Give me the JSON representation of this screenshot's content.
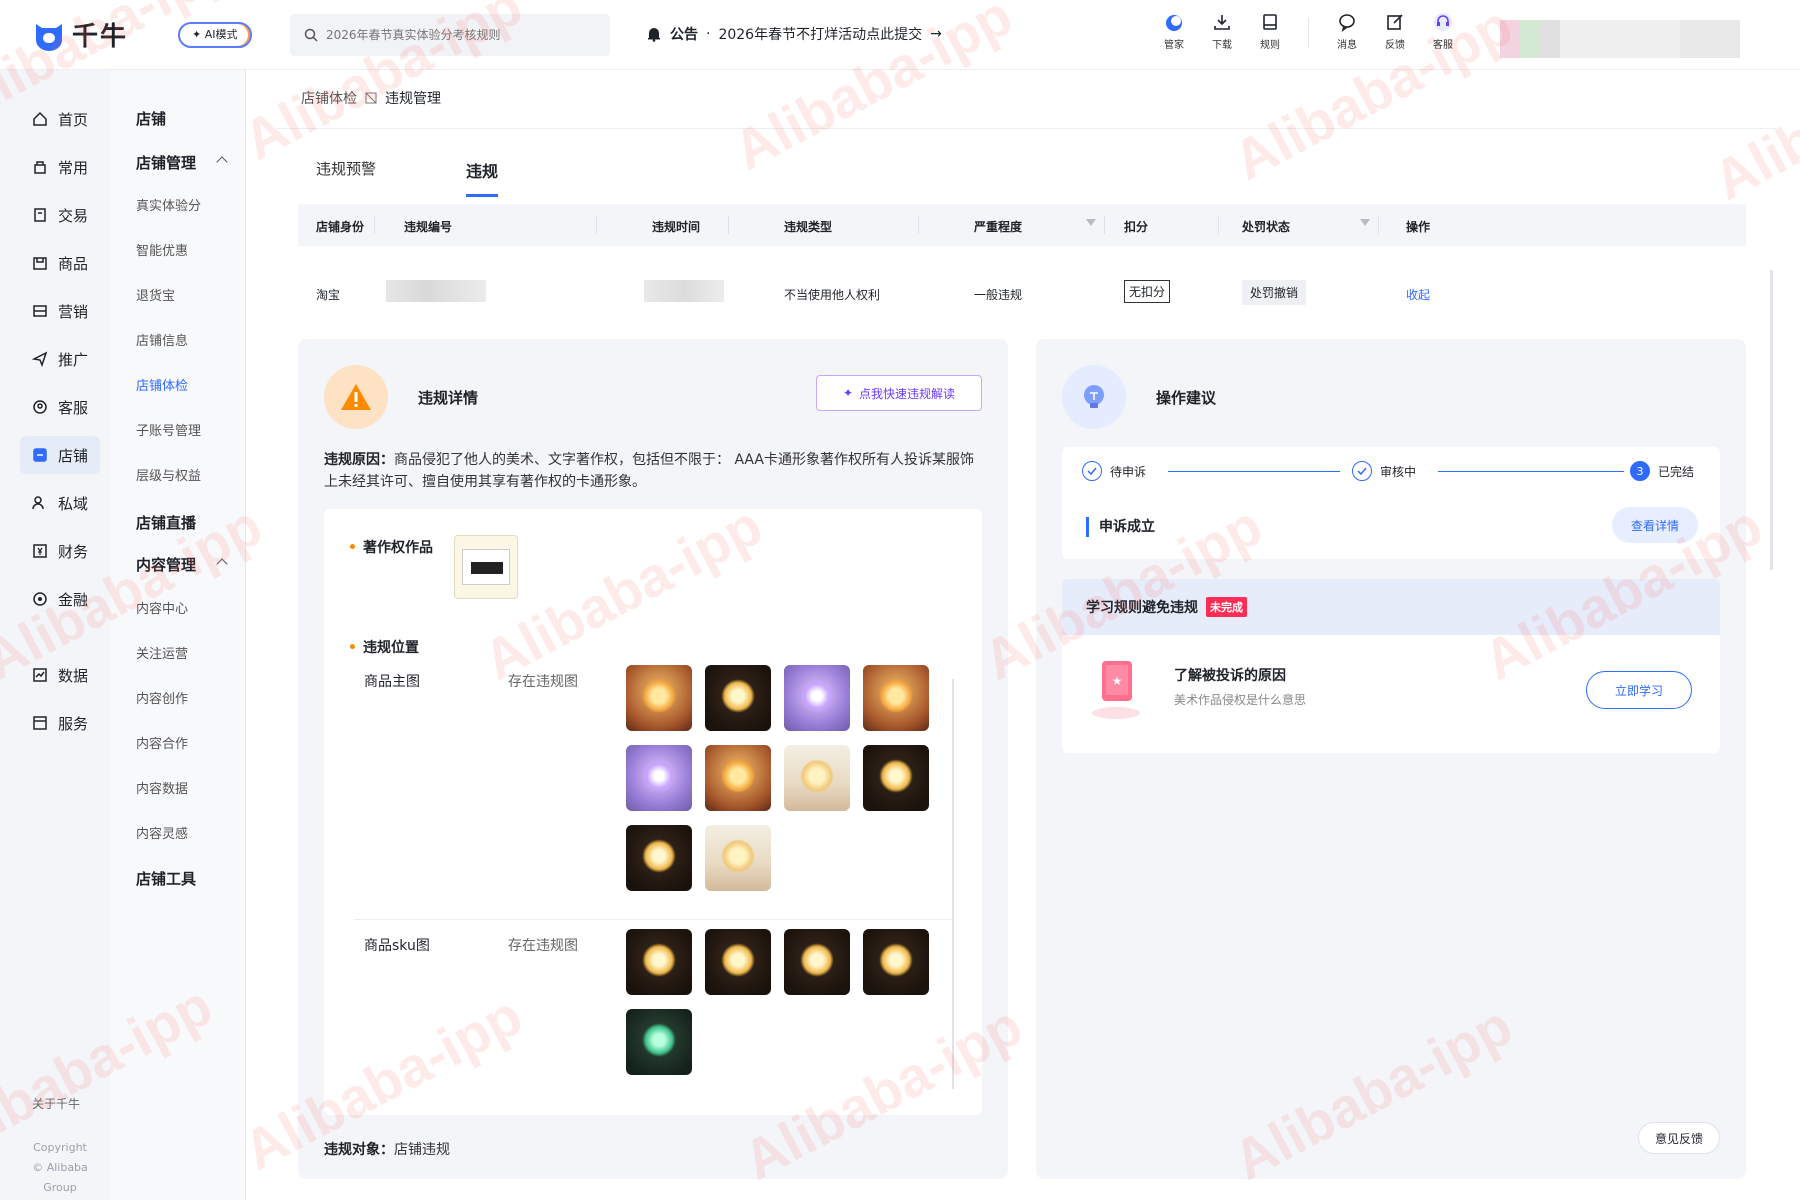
{
  "app": {
    "name": "千牛",
    "ai_mode": "AI模式"
  },
  "search": {
    "placeholder": "2026年春节真实体验分考核规则"
  },
  "notice": {
    "label": "公告",
    "sep": "·",
    "text": "2026年春节不打烊活动点此提交"
  },
  "top_icons": [
    {
      "label": "管家",
      "icon": "assistant-icon"
    },
    {
      "label": "下载",
      "icon": "download-icon"
    },
    {
      "label": "规则",
      "icon": "rule-book-icon"
    },
    {
      "label": "消息",
      "icon": "message-icon"
    },
    {
      "label": "反馈",
      "icon": "feedback-icon"
    },
    {
      "label": "客服",
      "icon": "headset-icon"
    }
  ],
  "nav_primary": [
    {
      "label": "首页",
      "icon": "home-icon"
    },
    {
      "label": "常用",
      "icon": "pin-icon"
    },
    {
      "label": "交易",
      "icon": "order-icon"
    },
    {
      "label": "商品",
      "icon": "goods-icon"
    },
    {
      "label": "营销",
      "icon": "marketing-icon"
    },
    {
      "label": "推广",
      "icon": "send-icon"
    },
    {
      "label": "客服",
      "icon": "service-icon"
    },
    {
      "label": "店铺",
      "icon": "shop-icon",
      "active": true
    },
    {
      "label": "私域",
      "icon": "users-icon"
    },
    {
      "label": "财务",
      "icon": "finance-icon"
    },
    {
      "label": "金融",
      "icon": "coin-icon"
    },
    {
      "label": "数据",
      "icon": "chart-icon"
    },
    {
      "label": "服务",
      "icon": "service-box-icon"
    }
  ],
  "nav_footer": {
    "about": "关于千牛",
    "copyright": "Copyright",
    "company": "© Alibaba Group"
  },
  "nav_secondary": {
    "shop": "店铺",
    "shop_manage": "店铺管理",
    "shop_manage_items": [
      "真实体验分",
      "智能优惠",
      "退货宝",
      "店铺信息",
      "店铺体检",
      "子账号管理",
      "层级与权益"
    ],
    "live": "店铺直播",
    "content_manage": "内容管理",
    "content_items": [
      "内容中心",
      "关注运营",
      "内容创作",
      "内容合作",
      "内容数据",
      "内容灵感"
    ],
    "tools": "店铺工具"
  },
  "breadcrumb": {
    "parent": "店铺体检",
    "current": "违规管理"
  },
  "tabs": [
    {
      "label": "违规预警"
    },
    {
      "label": "违规",
      "active": true
    }
  ],
  "table": {
    "headers": [
      "店铺身份",
      "违规编号",
      "违规时间",
      "违规类型",
      "严重程度",
      "扣分",
      "处罚状态",
      "操作"
    ],
    "row": {
      "identity": "淘宝",
      "type": "不当使用他人权利",
      "severity": "一般违规",
      "points": "无扣分",
      "status": "处罚撤销",
      "action": "收起"
    }
  },
  "detail": {
    "title": "违规详情",
    "ai_button": "点我快速违规解读",
    "reason_label": "违规原因：",
    "reason_text": "商品侵犯了他人的美术、文字著作权，包括但不限于： AAA卡通形象著作权所有人投诉某服饰上未经其许可、擅自使用其享有著作权的卡通形象。",
    "copyright_label": "著作权作品",
    "location_label": "违规位置",
    "main_image_label": "商品主图",
    "main_image_value": "存在违规图",
    "sku_image_label": "商品sku图",
    "sku_image_value": "存在违规图",
    "target_label": "违规对象：",
    "target_value": "店铺违规"
  },
  "advice": {
    "title": "操作建议",
    "steps": [
      "待申诉",
      "审核中",
      "已完结"
    ],
    "step3_num": "3",
    "appeal": "申诉成立",
    "detail_button": "查看详情",
    "learn_title": "学习规则避免违规",
    "learn_badge": "未完成",
    "course_title": "了解被投诉的原因",
    "course_sub": "美术作品侵权是什么意思",
    "course_button": "立即学习"
  },
  "feedback": "意见反馈",
  "watermark": "Alibaba-ipp",
  "colors": {
    "accent": "#2f6bff",
    "warning": "#ff8a00",
    "danger": "#ff2d55"
  }
}
